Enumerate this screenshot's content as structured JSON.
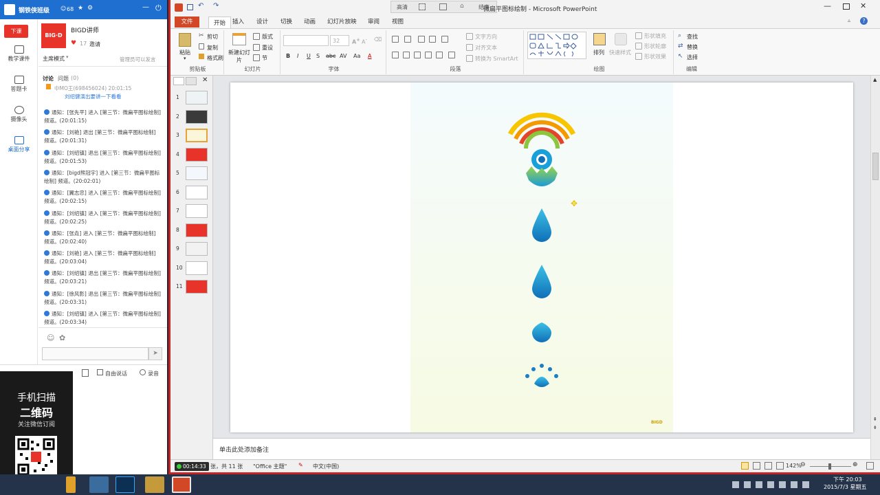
{
  "classroom": {
    "title": "钢铁侠班级",
    "viewers": "68",
    "end_class": "下课",
    "nav": [
      "教学课件",
      "答题卡",
      "摄像头",
      "桌面分享"
    ],
    "teacher_name": "BIGD讲师",
    "logo_text": "BIG·D",
    "likes": "17",
    "invite": "邀请",
    "mode": "主席模式",
    "admin_note": "管理员可以发言",
    "tab_discuss": "讨论",
    "tab_question": "问题",
    "question_count": "(0)",
    "pinned_user": "中MO王(698456024) 20:01:15",
    "pinned_text": "刘绍健演出要讲一下看看",
    "messages": [
      "通知：[张先平] 进入 [第三节：微扁平图标绘制] 频道。(20:01:15)",
      "通知：[刘艳] 退出 [第三节：微扁平图标绘制] 频道。(20:01:31)",
      "通知：[刘绍镇] 退出 [第三节：微扁平图标绘制] 频道。(20:01:53)",
      "通知：[bigd熊冠宇] 进入 [第三节：微扁平图标绘制] 频道。(20:02:01)",
      "通知：[翼志忠] 进入 [第三节：微扁平图标绘制] 频道。(20:02:15)",
      "通知：[刘绍镇] 进入 [第三节：微扁平图标绘制] 频道。(20:02:25)",
      "通知：[张垚] 进入 [第三节：微扁平图标绘制] 频道。(20:02:40)",
      "通知：[刘艳] 进入 [第三节：微扁平图标绘制] 频道。(20:03:04)",
      "通知：[刘绍镇] 退出 [第三节：微扁平图标绘制] 频道。(20:03:21)",
      "通知：[徐风影] 退出 [第三节：微扁平图标绘制] 频道。(20:03:31)",
      "通知：[刘绍镇] 进入 [第三节：微扁平图标绘制] 频道。(20:03:34)"
    ],
    "free_talk": "自由说话",
    "record": "录音",
    "qr_line1": "手机扫描",
    "qr_line2": "二维码",
    "qr_line3": "关注微信订阅"
  },
  "ppt": {
    "title": "微扁平图标绘制 - Microsoft PowerPoint",
    "floatbar": [
      "高清",
      "结束"
    ],
    "file_tab": "文件",
    "tabs": [
      "开始",
      "插入",
      "设计",
      "切换",
      "动画",
      "幻灯片放映",
      "审阅",
      "视图"
    ],
    "clipboard": {
      "paste": "粘贴",
      "cut": "剪切",
      "copy": "复制",
      "format_painter": "格式刷",
      "label": "剪贴板"
    },
    "slides": {
      "new_slide": "新建幻灯片",
      "layout": "版式",
      "reset": "重设",
      "section": "节",
      "label": "幻灯片"
    },
    "font": {
      "size": "32",
      "label": "字体"
    },
    "paragraph": {
      "text_direction": "文字方向",
      "align_text": "对齐文本",
      "smartart": "转换为 SmartArt",
      "label": "段落"
    },
    "drawing": {
      "arrange": "排列",
      "quick_styles": "快速样式",
      "fill": "形状填充",
      "outline": "形状轮廓",
      "effects": "形状效果",
      "label": "绘图"
    },
    "editing": {
      "find": "查找",
      "replace": "替换",
      "select": "选择",
      "label": "编辑"
    },
    "slide_count": 11,
    "active_slide": 3,
    "slide_brand": "BIGD",
    "notes_placeholder": "单击此处添加备注",
    "status_timer": "00:14:33",
    "status_slides": "张，共 11 张",
    "status_theme": "\"Office 主题\"",
    "status_lang": "中文(中国)",
    "zoom": "142%"
  },
  "taskbar": {
    "time": "下午 20:03",
    "date": "2015/7/3 星期五"
  },
  "colors": {
    "accent_red": "#e8332a",
    "ppt_orange": "#d24726",
    "drop_blue": "#1aa0d8",
    "rainbow": [
      "#f7c600",
      "#f49a00",
      "#e4452a",
      "#8cc53f",
      "#1aa0d8"
    ]
  }
}
